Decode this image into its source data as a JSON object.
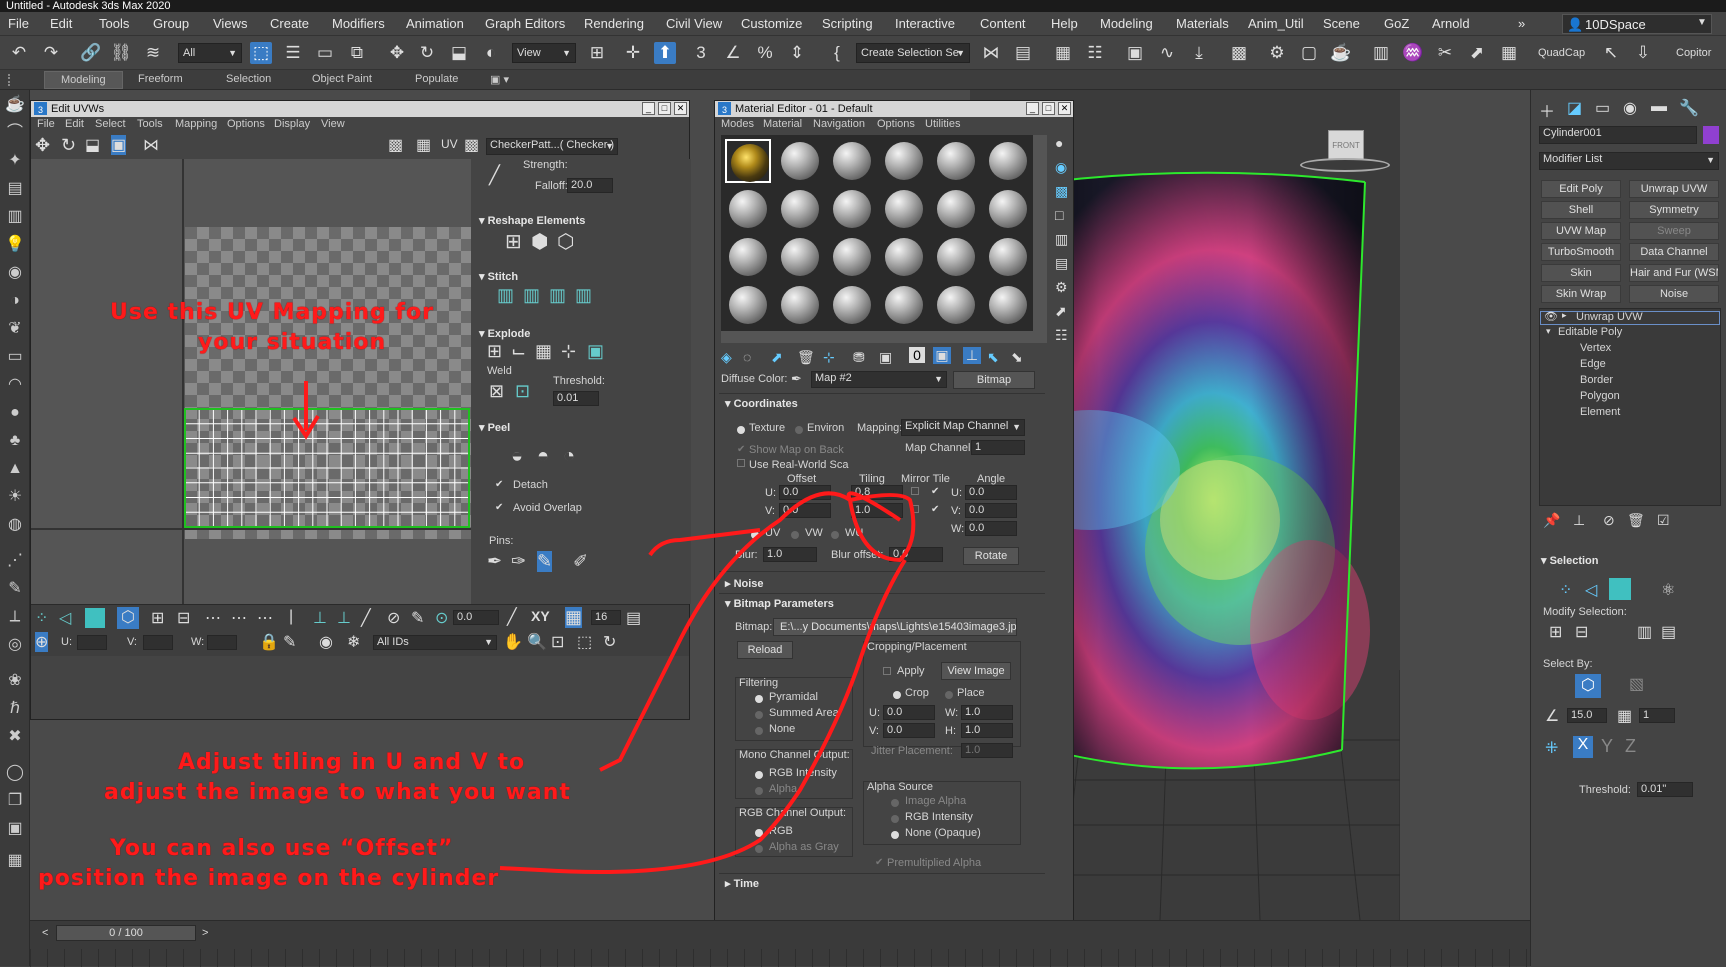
{
  "app_title": "Untitled - Autodesk 3ds Max 2020",
  "menu": [
    "File",
    "Edit",
    "Tools",
    "Group",
    "Views",
    "Create",
    "Modifiers",
    "Animation",
    "Graph Editors",
    "Rendering",
    "Civil View",
    "Customize",
    "Scripting",
    "Interactive",
    "Content",
    "Help",
    "Modeling",
    "Materials",
    "Anim_Util",
    "Scene",
    "GoZ",
    "Arnold"
  ],
  "workspace": "10DSpace",
  "toolbar": {
    "filter": "All",
    "view": "View",
    "selection_set": "Create Selection Se",
    "quadcap": "QuadCap",
    "copitor": "Copitor"
  },
  "ribbon_tabs": [
    "Modeling",
    "Freeform",
    "Selection",
    "Object Paint",
    "Populate"
  ],
  "uvw": {
    "title": "Edit UVWs",
    "menu": [
      "File",
      "Edit",
      "Select",
      "Tools",
      "Mapping",
      "Options",
      "Display",
      "View"
    ],
    "uv_label": "UV",
    "checker": "CheckerPatt...( Checker )",
    "strength_label": "Strength:",
    "falloff_label": "Falloff:",
    "falloff": "20.0",
    "reshape": "Reshape Elements",
    "stitch": "Stitch",
    "explode": "Explode",
    "weld": "Weld",
    "threshold_label": "Threshold:",
    "threshold": "0.01",
    "peel": "Peel",
    "detach": "Detach",
    "avoid_overlap": "Avoid Overlap",
    "pins": "Pins:",
    "spin_value": "0.0",
    "xy": "XY",
    "count": "16",
    "u_label": "U:",
    "v_label": "V:",
    "w_label": "W:",
    "ids": "All IDs"
  },
  "material_editor": {
    "title": "Material Editor - 01 - Default",
    "menu": [
      "Modes",
      "Material",
      "Navigation",
      "Options",
      "Utilities"
    ],
    "diffuse_label": "Diffuse Color:",
    "map_name": "Map #2",
    "map_type": "Bitmap",
    "coordinates": "Coordinates",
    "texture": "Texture",
    "environ": "Environ",
    "mapping_label": "Mapping:",
    "mapping": "Explicit Map Channel",
    "show_map": "Show Map on Back",
    "map_channel_label": "Map Channel:",
    "map_channel": "1",
    "real_world": "Use Real-World Sca",
    "offset": "Offset",
    "tiling": "Tiling",
    "mirror_tile": "Mirror Tile",
    "angle": "Angle",
    "u_offset": "0.0",
    "v_offset": "0.0",
    "u_tiling": "0.8",
    "v_tiling": "1.0",
    "u_angle": "0.0",
    "v_angle": "0.0",
    "w_angle": "0.0",
    "uv": "UV",
    "vw": "VW",
    "wu": "WU",
    "blur_label": "Blur:",
    "blur": "1.0",
    "blur_offset_label": "Blur offset:",
    "blur_offset": "0.0",
    "rotate": "Rotate",
    "noise": "Noise",
    "bitmap_params": "Bitmap Parameters",
    "bitmap_label": "Bitmap:",
    "bitmap_path": "E:\\...y Documents\\maps\\Lights\\e15403image3.jpg",
    "reload": "Reload",
    "cropping": "Cropping/Placement",
    "apply": "Apply",
    "view_image": "View Image",
    "crop": "Crop",
    "place": "Place",
    "filtering": "Filtering",
    "pyramidal": "Pyramidal",
    "summed_area": "Summed Area",
    "none": "None",
    "crop_u": "0.0",
    "crop_v": "0.0",
    "crop_w": "1.0",
    "crop_h": "1.0",
    "jitter": "Jitter Placement:",
    "jitter_val": "1.0",
    "mono_output": "Mono Channel Output:",
    "rgb_intensity": "RGB Intensity",
    "alpha": "Alpha",
    "alpha_source": "Alpha Source",
    "image_alpha": "Image Alpha",
    "none_opaque": "None (Opaque)",
    "rgb_output": "RGB Channel Output:",
    "rgb": "RGB",
    "alpha_as_gray": "Alpha as Gray",
    "premult": "Premultiplied Alpha",
    "time": "Time"
  },
  "command_panel": {
    "object_name": "Cylinder001",
    "modifier_list": "Modifier List",
    "buttons": [
      "Edit Poly",
      "Unwrap UVW",
      "Shell",
      "Symmetry",
      "UVW Map",
      "Sweep",
      "TurboSmooth",
      "Data Channel",
      "Skin",
      "Hair and Fur (WSM",
      "Skin Wrap",
      "Noise"
    ],
    "stack": [
      "Unwrap UVW",
      "Editable Poly",
      "Vertex",
      "Edge",
      "Border",
      "Polygon",
      "Element"
    ],
    "selection": "Selection",
    "modify_selection": "Modify Selection:",
    "select_by": "Select By:",
    "angle_val": "15.0",
    "count_val": "1",
    "threshold_label": "Threshold:",
    "threshold": "0.01\""
  },
  "timeline": "0 / 100",
  "annotations": {
    "a1": "Use this UV Mapping for",
    "a2": "your situation",
    "a3": "Adjust tiling in U and V to",
    "a4": "adjust the image to what you want",
    "a5": "You can also use “Offset”",
    "a6": "position the image on the cylinder"
  },
  "colors": {
    "accent": "#3a7cc4",
    "annotation": "#ff1a1a",
    "uv_wire": "#20c020"
  }
}
